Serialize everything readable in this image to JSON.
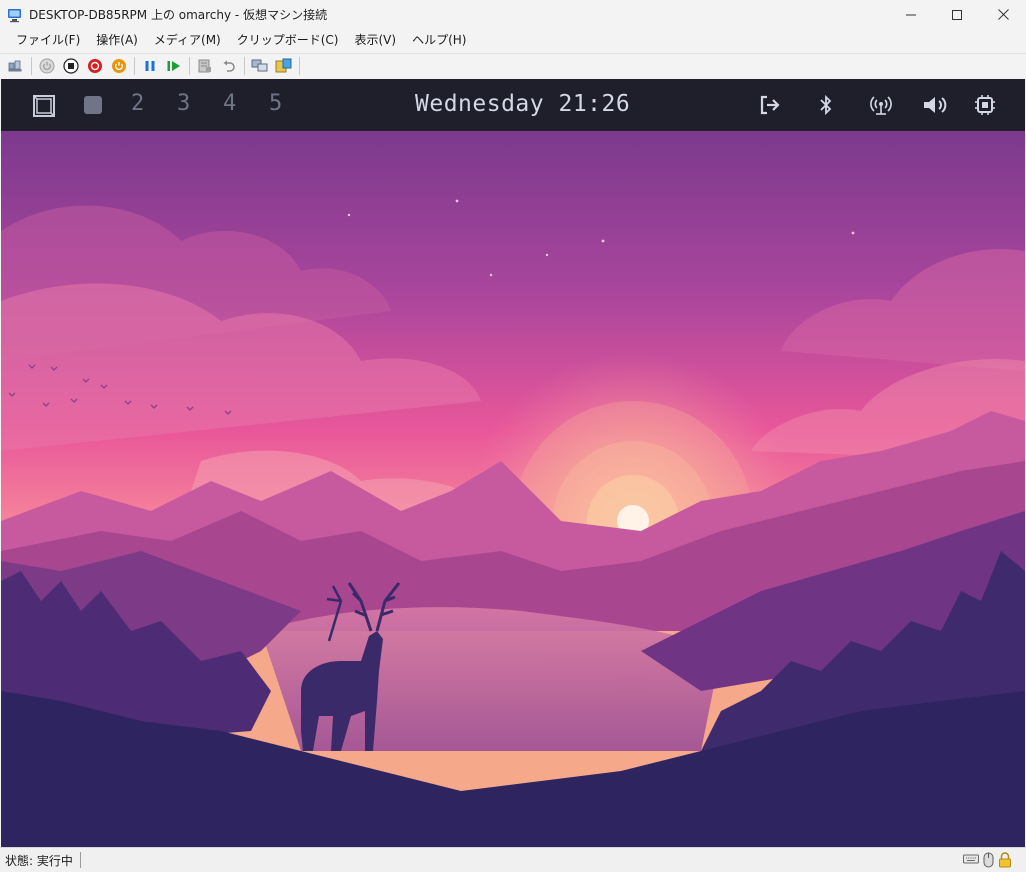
{
  "window": {
    "title": "DESKTOP-DB85RPM 上の omarchy  - 仮想マシン接続",
    "controls": [
      "minimize-icon",
      "maximize-icon",
      "close-icon"
    ]
  },
  "menu": {
    "items": [
      "ファイル(F)",
      "操作(A)",
      "メディア(M)",
      "クリップボード(C)",
      "表示(V)",
      "ヘルプ(H)"
    ]
  },
  "toolbar": {
    "icons": [
      "ctrl-alt-del-icon",
      "start-icon",
      "turn-off-icon",
      "shutdown-icon",
      "power-icon",
      "pause-icon",
      "resume-icon",
      "checkpoint-icon",
      "revert-icon",
      "enhanced-session-icon",
      "share-icon"
    ],
    "colors": {
      "stop_red": "#d81e1e",
      "power_orange": "#e8950f",
      "pause_blue": "#1a73d9",
      "resume_green": "#1c9e3a"
    }
  },
  "vm": {
    "waybar": {
      "workspaces": [
        "2",
        "3",
        "4",
        "5"
      ],
      "clock": "Wednesday 21:26",
      "tray_icons": [
        "logout-icon",
        "bluetooth-icon",
        "network-icon",
        "volume-icon",
        "cpu-icon"
      ],
      "colors": {
        "background": "#1e1f2b",
        "text": "#d3d7e6",
        "inactive": "#6f7486"
      }
    },
    "wallpaper": {
      "description_colors": {
        "sky_top": "#7a3a8c",
        "sky_mid": "#ea5a9a",
        "horizon": "#f6a98a",
        "sun": "#fff0e0",
        "ground": "#2e2460"
      }
    }
  },
  "status": {
    "text": "状態: 実行中",
    "icons": [
      "keyboard-icon",
      "mouse-icon",
      "lock-icon"
    ]
  }
}
